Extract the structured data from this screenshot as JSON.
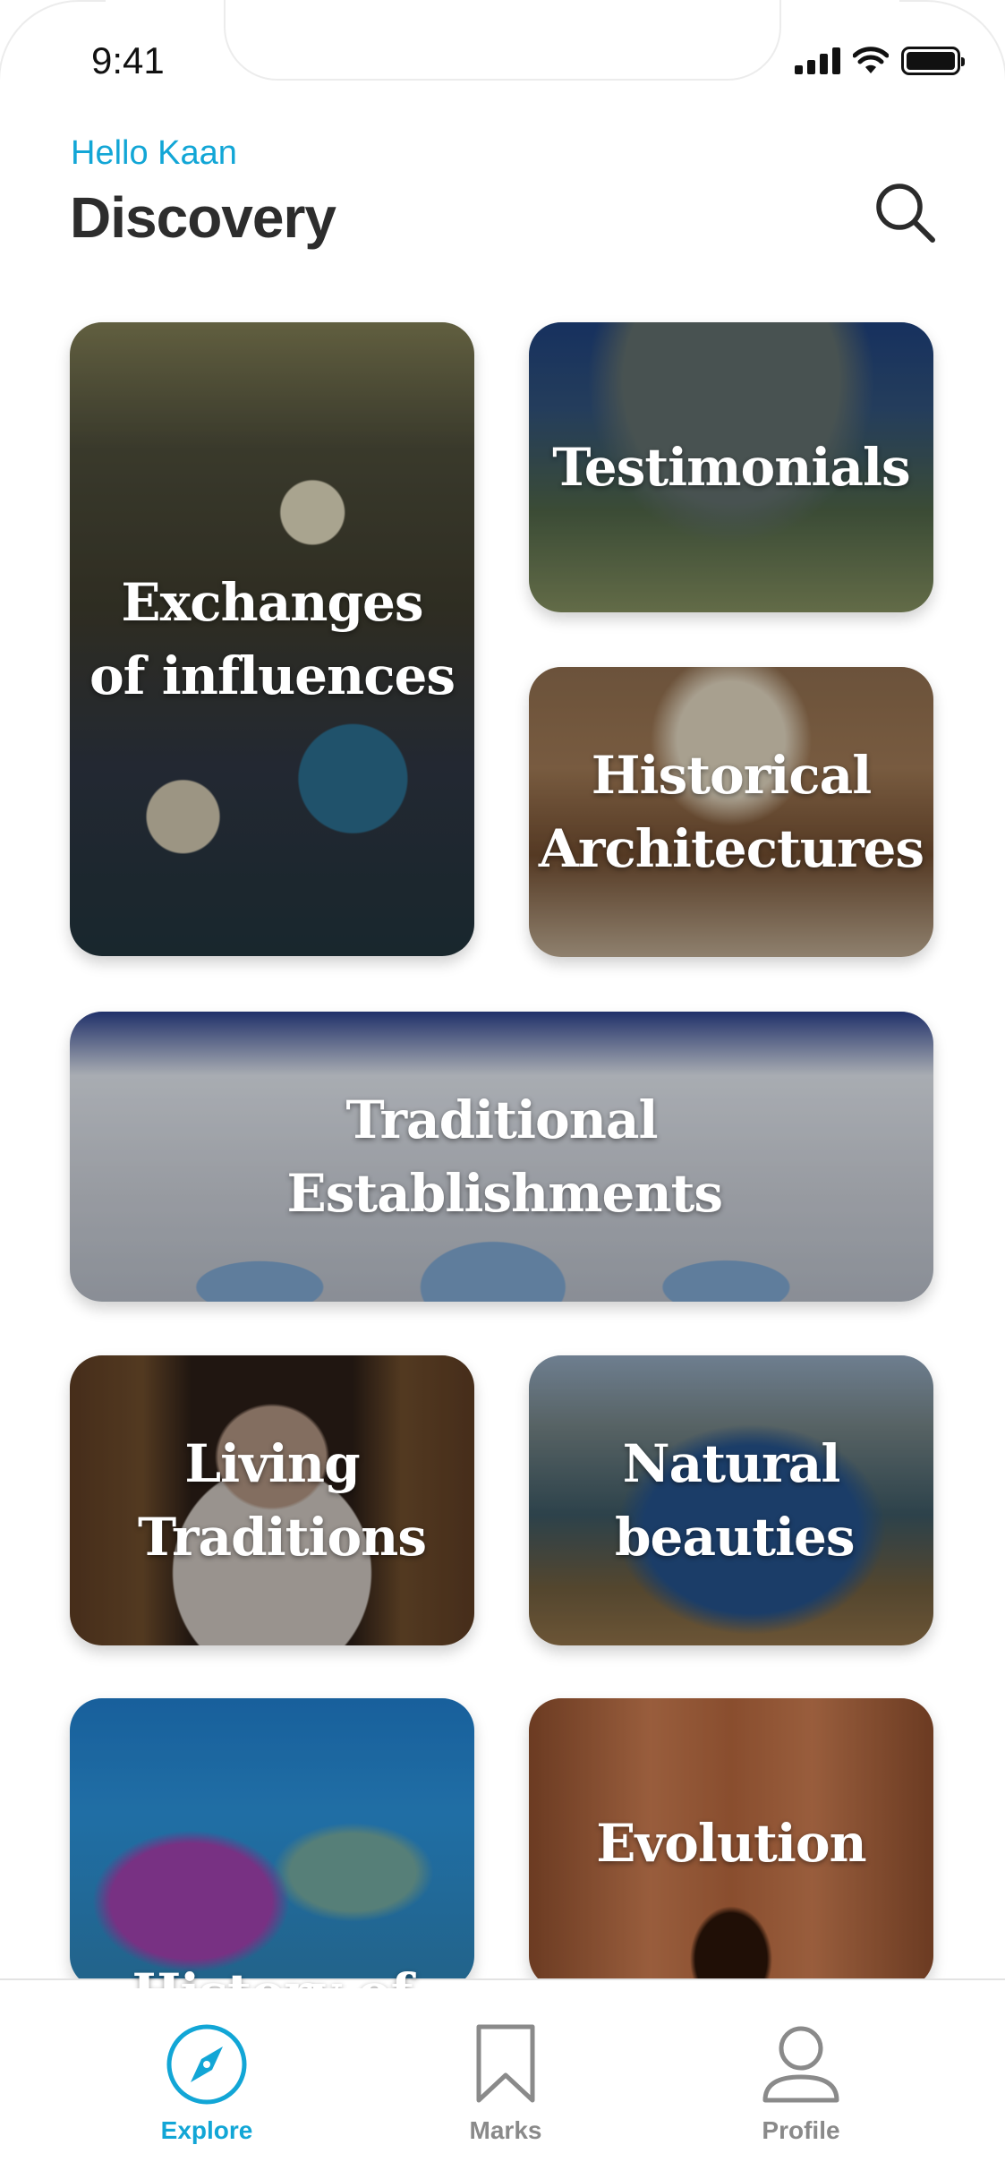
{
  "status_bar": {
    "time": "9:41",
    "icons": [
      "signal-icon",
      "wifi-icon",
      "battery-icon"
    ]
  },
  "header": {
    "greeting": "Hello Kaan",
    "title": "Discovery",
    "search_icon": "search-icon"
  },
  "cards": [
    {
      "label": "Exchanges of influences"
    },
    {
      "label": "Testimonials"
    },
    {
      "label": "Historical Architectures"
    },
    {
      "label": "Traditional Establishments"
    },
    {
      "label": "Living Traditions"
    },
    {
      "label": "Natural beauties"
    },
    {
      "label": "History of"
    },
    {
      "label": "Evolution"
    }
  ],
  "bottom_nav": {
    "items": [
      {
        "label": "Explore",
        "icon": "compass-icon",
        "active": true
      },
      {
        "label": "Marks",
        "icon": "bookmark-icon",
        "active": false
      },
      {
        "label": "Profile",
        "icon": "user-icon",
        "active": false
      }
    ]
  },
  "colors": {
    "accent": "#12a6d6",
    "title": "#2d2d2d",
    "inactive_nav": "#8a8a8a"
  }
}
